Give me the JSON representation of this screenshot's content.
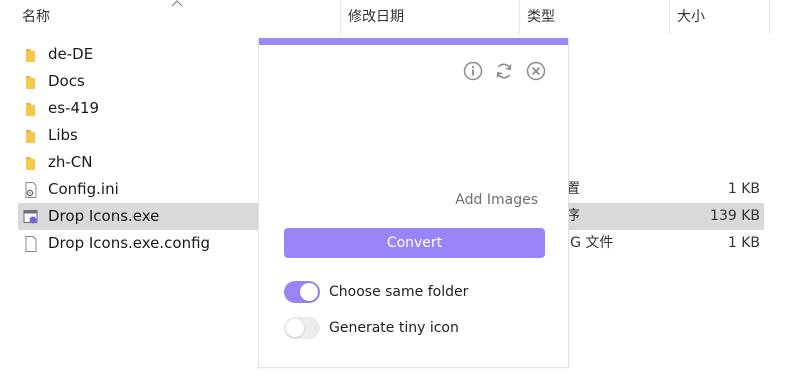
{
  "header": {
    "columns": [
      "名称",
      "修改日期",
      "类型",
      "大小"
    ]
  },
  "files": [
    {
      "name": "de-DE",
      "icon": "folder-icon",
      "type": "",
      "size": "",
      "selected": false
    },
    {
      "name": "Docs",
      "icon": "folder-icon",
      "type": "",
      "size": "",
      "selected": false
    },
    {
      "name": "es-419",
      "icon": "folder-icon",
      "type": "",
      "size": "",
      "selected": false
    },
    {
      "name": "Libs",
      "icon": "folder-icon",
      "type": "",
      "size": "",
      "selected": false
    },
    {
      "name": "zh-CN",
      "icon": "folder-icon",
      "type": "",
      "size": "",
      "selected": false
    },
    {
      "name": "Config.ini",
      "icon": "config-file-icon",
      "type": "置",
      "size": "1 KB",
      "selected": false
    },
    {
      "name": "Drop Icons.exe",
      "icon": "exe-file-icon",
      "type": "序",
      "size": "139 KB",
      "selected": true
    },
    {
      "name": "Drop Icons.exe.config",
      "icon": "file-icon",
      "type": "IG 文件",
      "size": "1 KB",
      "selected": false
    }
  ],
  "partial_type_glyphs": [
    "",
    "",
    "",
    "",
    ""
  ],
  "popup": {
    "accent": "#9b87f5",
    "icons": [
      "info-icon",
      "refresh-icon",
      "close-icon"
    ],
    "add_images": "Add Images",
    "convert_label": "Convert",
    "options": [
      {
        "label": "Choose same folder",
        "on": true
      },
      {
        "label": "Generate tiny icon",
        "on": false
      }
    ]
  }
}
